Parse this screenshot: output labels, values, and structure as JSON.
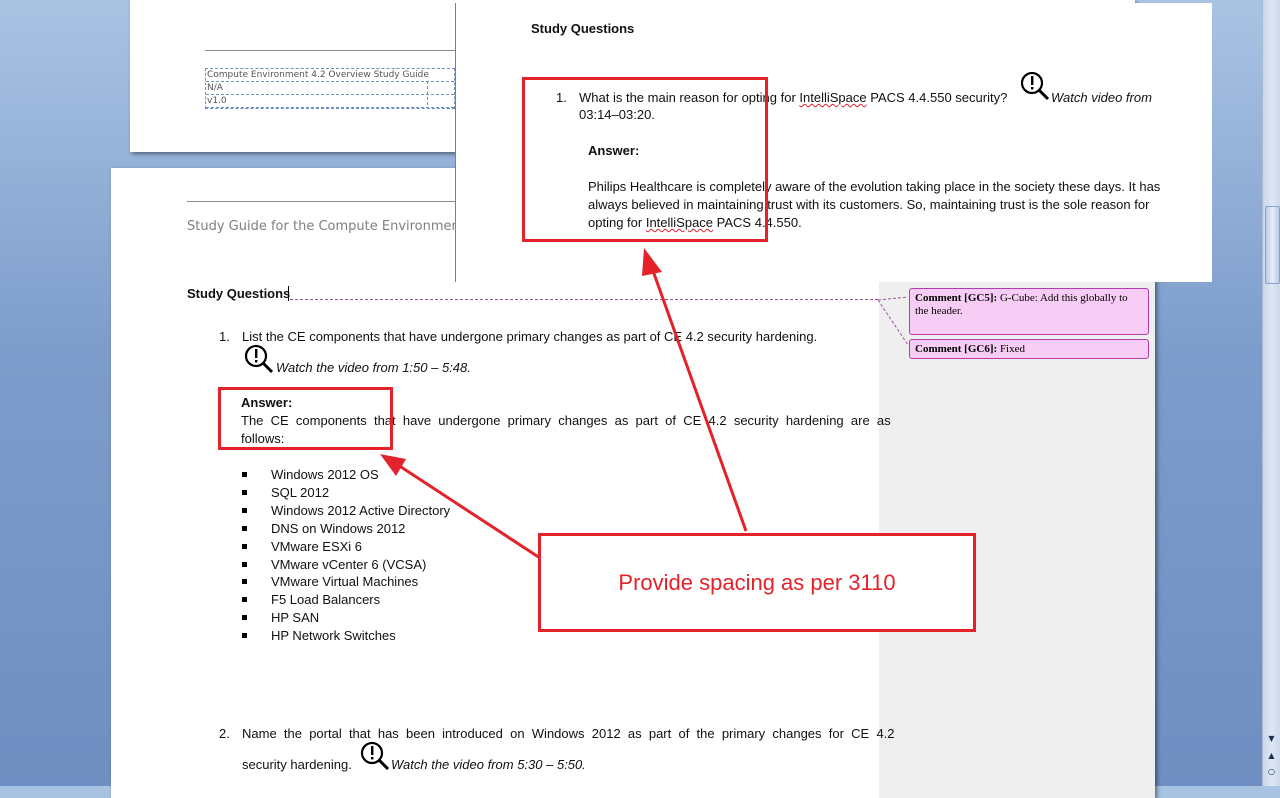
{
  "top_page": {
    "header_table": [
      "Compute Environment 4.2 Overview Study Guide",
      "N/A",
      "v1.0"
    ]
  },
  "main_page": {
    "header_text": "Study Guide for the Compute Environment (C",
    "section_title": "Study Questions",
    "q1": {
      "number": "1.",
      "text": "List the CE components that have undergone primary changes as part of CE 4.2 security hardening.",
      "video": "Watch the video from 1:50 – 5:48.",
      "answer_label": "Answer:",
      "answer_line1": "The  CE  components  that  have  undergone  primary  changes  as  part  of  CE  4.2  security  hardening  are  as",
      "answer_line2": "follows:",
      "items": [
        "Windows 2012 OS",
        "SQL 2012",
        "Windows 2012 Active Directory",
        "DNS on Windows 2012",
        "VMware ESXi 6",
        "VMware vCenter 6 (VCSA)",
        "VMware Virtual Machines",
        "F5 Load Balancers",
        "HP SAN",
        "HP Network Switches"
      ]
    },
    "q2": {
      "number": "2.",
      "line1": "Name  the  portal  that  has  been  introduced  on  Windows  2012  as  part  of  the  primary  changes  for  CE  4.2",
      "line2": "security hardening.",
      "video": "Watch the video from 5:30 – 5:50."
    }
  },
  "comments": [
    {
      "label": "Comment [GC5]:",
      "text": "G-Cube: Add this globally to the header."
    },
    {
      "label": "Comment [GC6]:",
      "text": "Fixed"
    }
  ],
  "popup": {
    "title": "Study Questions",
    "q_number": "1.",
    "q_text_a": "What is the main reason for opting for",
    "q_text_b": "IntelliSpace",
    "q_text_c": "PACS 4.4.550 security?",
    "video_a": "Watch video from",
    "video_b": "03:14–03:20.",
    "answer_label": "Answer:",
    "answer_l1": "Philips Healthcare is completely aware of the evolution taking place in the society these days. It has",
    "answer_l2": "always believed in maintaining trust with its customers. So, maintaining trust is the sole reason for",
    "answer_l3a": "opting for",
    "answer_l3b": "IntelliSpace",
    "answer_l3c": "PACS 4.4.550."
  },
  "callout": "Provide spacing as per 3110",
  "colors": {
    "annotation_red": "#e3222a",
    "comment_pink": "#f7ccf5",
    "comment_border": "#b03cb0"
  }
}
